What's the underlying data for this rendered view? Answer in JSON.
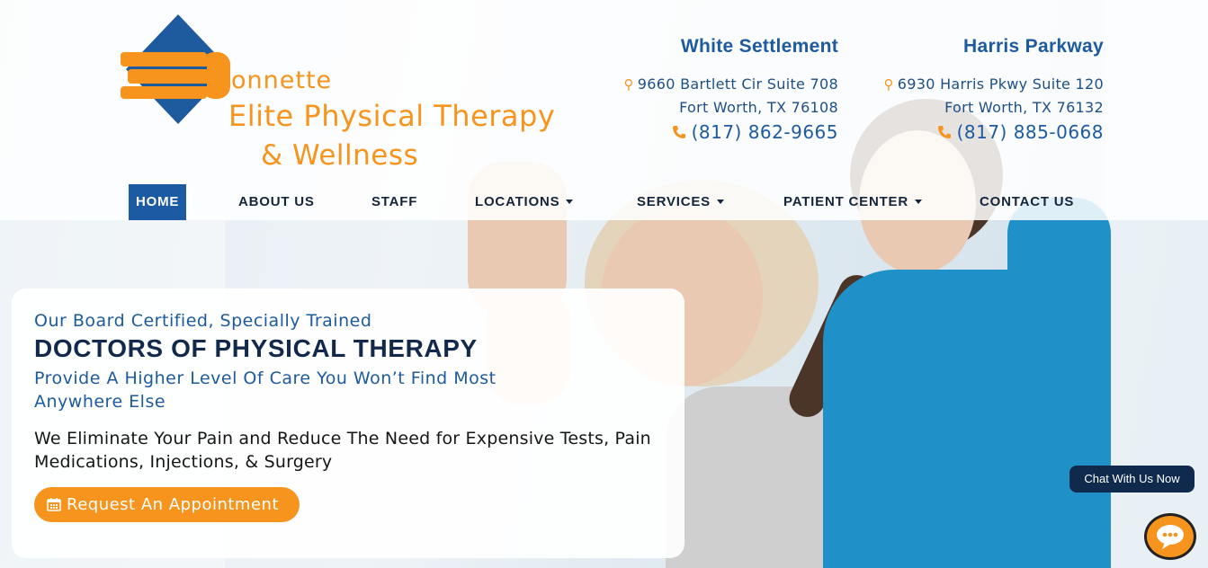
{
  "brand": {
    "logo_line1": "onnette",
    "logo_line2": "Elite Physical Therapy",
    "logo_line3": "& Wellness",
    "colors": {
      "orange": "#f7941d",
      "blue": "#1d5a9e",
      "navy": "#13294b"
    }
  },
  "locations": [
    {
      "name": "White Settlement",
      "address1": "9660 Bartlett Cir Suite 708",
      "address2": "Fort Worth, TX 76108",
      "phone": "(817) 862-9665"
    },
    {
      "name": "Harris Parkway",
      "address1": "6930 Harris Pkwy Suite 120",
      "address2": "Fort Worth, TX 76132",
      "phone": "(817) 885-0668"
    }
  ],
  "nav": {
    "items": [
      {
        "label": "HOME",
        "active": true
      },
      {
        "label": "ABOUT US"
      },
      {
        "label": "STAFF"
      },
      {
        "label": "LOCATIONS",
        "dropdown": true
      },
      {
        "label": "SERVICES",
        "dropdown": true
      },
      {
        "label": "PATIENT CENTER",
        "dropdown": true
      },
      {
        "label": "CONTACT US"
      }
    ]
  },
  "hero": {
    "pre_heading": "Our Board Certified, Specially Trained",
    "headline": "DOCTORS OF PHYSICAL THERAPY",
    "subheading": "Provide A Higher Level Of Care You Won’t Find Most Anywhere Else",
    "body": "We Eliminate Your Pain and Reduce The Need for Expensive Tests, Pain Medications, Injections, & Surgery",
    "cta_label": "Request An Appointment",
    "cta_icon": "calendar-icon"
  },
  "chat": {
    "label": "Chat With Us Now",
    "icon": "chat-bubble-icon"
  }
}
